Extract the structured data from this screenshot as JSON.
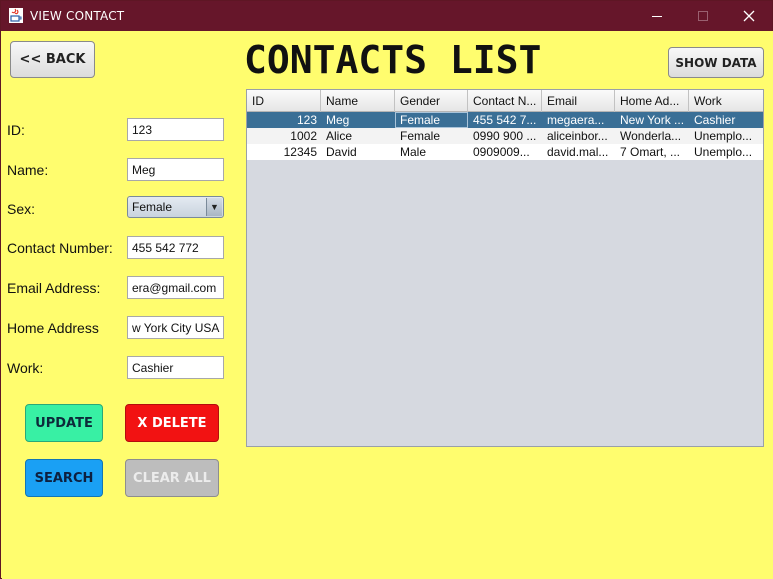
{
  "window": {
    "title": "VIEW CONTACT"
  },
  "header": {
    "back_label": "<< BACK",
    "title": "CONTACTS LIST",
    "show_data_label": "SHOW DATA"
  },
  "form": {
    "id_label": "ID:",
    "id_value": "123",
    "name_label": "Name:",
    "name_value": "Meg",
    "sex_label": "Sex:",
    "sex_value": "Female",
    "contact_label": "Contact Number:",
    "contact_value": "455 542 772",
    "email_label": "Email Address:",
    "email_value": "era@gmail.com",
    "address_label": "Home Address",
    "address_value": "w York City USA",
    "work_label": "Work:",
    "work_value": "Cashier"
  },
  "actions": {
    "update": "UPDATE",
    "delete": "X DELETE",
    "search": "SEARCH",
    "clear": "CLEAR ALL"
  },
  "table": {
    "columns": [
      "ID",
      "Name",
      "Gender",
      "Contact N...",
      "Email",
      "Home Ad...",
      "Work"
    ],
    "rows": [
      [
        "123",
        "Meg",
        "Female",
        "455 542 7...",
        "megaera...",
        "New York ...",
        "Cashier"
      ],
      [
        "1002",
        "Alice",
        "Female",
        "0990 900 ...",
        "aliceinbor...",
        "Wonderla...",
        "Unemplo..."
      ],
      [
        "12345",
        "David",
        "Male",
        "0909009...",
        "david.mal...",
        "7 Omart, ...",
        "Unemplo..."
      ]
    ],
    "selected_row": 0
  },
  "colors": {
    "titlebar": "#66162a",
    "background": "#fffd6e",
    "update": "#38f0a4",
    "delete": "#f21212",
    "search": "#1aa0f4",
    "clear": "#bdbdbd",
    "selection": "#3a6f96"
  }
}
